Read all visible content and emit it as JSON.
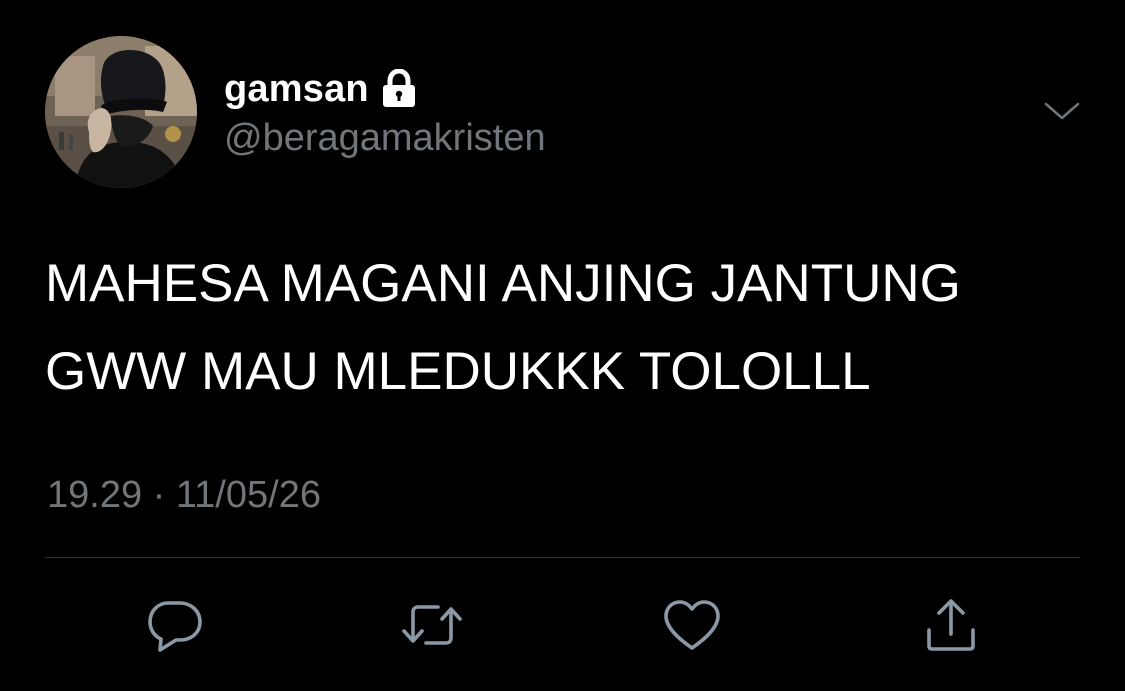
{
  "colors": {
    "background": "#000000",
    "primary_text": "#ffffff",
    "secondary_text": "#71767b",
    "divider": "#2f3336",
    "icon": "#8b98a5"
  },
  "author": {
    "display_name": "gamsan",
    "handle": "@beragamakristen",
    "protected_icon": "lock-icon",
    "avatar_icon": "avatar"
  },
  "tweet": {
    "text_lines": [
      "MAHESA MAGANI ANJING JANTUNG",
      "GWW MAU MLEDUKKK TOLOLLL"
    ],
    "timestamp": "19.29 · 11/05/26"
  },
  "menu": {
    "icon": "chevron-down-icon"
  },
  "actions": [
    {
      "name": "reply",
      "icon": "reply-icon"
    },
    {
      "name": "retweet",
      "icon": "retweet-icon"
    },
    {
      "name": "like",
      "icon": "heart-icon"
    },
    {
      "name": "share",
      "icon": "share-icon"
    }
  ]
}
